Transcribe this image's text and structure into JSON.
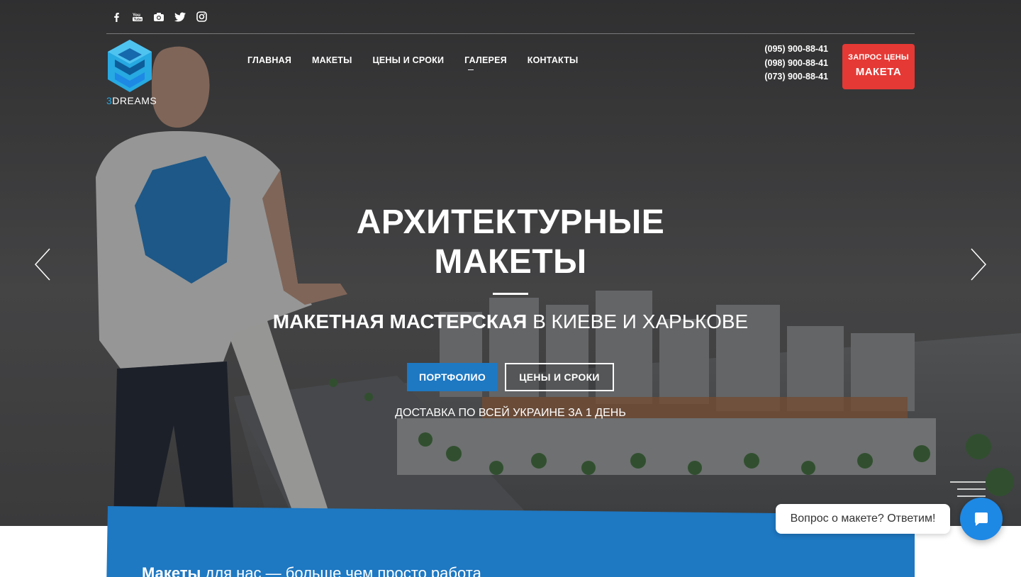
{
  "social": {
    "icons": [
      "facebook-icon",
      "youtube-icon",
      "camera-icon",
      "twitter-icon",
      "instagram-icon"
    ]
  },
  "logo": {
    "prefix": "3",
    "name": "DREAMS"
  },
  "nav": {
    "items": [
      {
        "label": "ГЛАВНАЯ"
      },
      {
        "label": "МАКЕТЫ"
      },
      {
        "label": "ЦЕНЫ И СРОКИ"
      },
      {
        "label": "ГАЛЕРЕЯ"
      },
      {
        "label": "КОНТАКТЫ"
      }
    ]
  },
  "phones": [
    "(095) 900-88-41",
    "(098) 900-88-41",
    "(073) 900-88-41"
  ],
  "quote_button": {
    "line1": "ЗАПРОС ЦЕНЫ",
    "line2": "МАКЕТА"
  },
  "hero": {
    "title_line1": "АРХИТЕКТУРНЫЕ",
    "title_line2": "МАКЕТЫ",
    "subtitle_bold": "МАКЕТНАЯ МАСТЕРСКАЯ",
    "subtitle_rest": " В КИЕВЕ И ХАРЬКОВЕ",
    "btn_portfolio": "ПОРТФОЛИО",
    "btn_prices": "ЦЕНЫ И СРОКИ",
    "delivery": "ДОСТАВКА ПО ВСЕЙ УКРАИНЕ ЗА 1 ДЕНЬ"
  },
  "panel": {
    "text_bold": "Макеты",
    "text_rest": " для нас — больше чем просто работа"
  },
  "chat": {
    "bubble": "Вопрос о макете? Ответим!"
  },
  "colors": {
    "accent_blue": "#1e78c2",
    "accent_red": "#e53935",
    "logo_blue": "#27a9e1"
  }
}
